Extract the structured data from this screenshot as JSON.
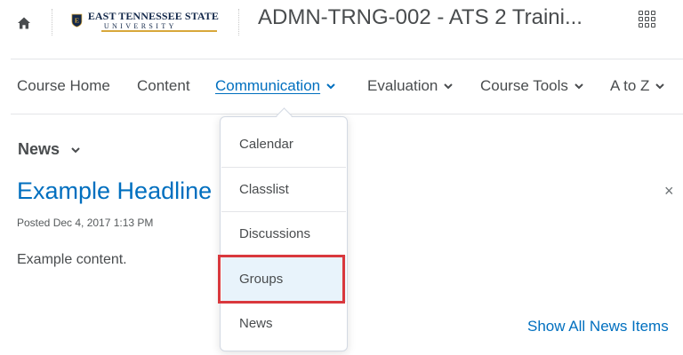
{
  "header": {
    "home_icon": "home-icon",
    "logo": {
      "line1": "EAST TENNESSEE STATE",
      "line2": "UNIVERSITY",
      "shield_letter": "E",
      "navy": "#13284a",
      "gold": "#d8a73a"
    },
    "course_title": "ADMN-TRNG-002 - ATS 2 Traini...",
    "apps_icon": "waffle-grid-icon"
  },
  "nav": {
    "items": [
      {
        "label": "Course Home",
        "has_menu": false
      },
      {
        "label": "Content",
        "has_menu": false
      },
      {
        "label": "Communication",
        "has_menu": true,
        "active": true
      },
      {
        "label": "Evaluation",
        "has_menu": true
      },
      {
        "label": "Course Tools",
        "has_menu": true
      },
      {
        "label": "A to Z",
        "has_menu": true
      }
    ]
  },
  "dropdown": {
    "items": [
      {
        "label": "Calendar"
      },
      {
        "label": "Classlist"
      },
      {
        "label": "Discussions"
      },
      {
        "label": "Groups",
        "highlighted": true
      },
      {
        "label": "News"
      }
    ]
  },
  "news": {
    "heading": "News",
    "headline": "Example Headline",
    "posted": "Posted Dec 4, 2017 1:13 PM",
    "content": "Example content.",
    "close": "×",
    "show_all": "Show All News Items"
  },
  "colors": {
    "link": "#006fbf",
    "text": "#494c4e",
    "highlight_border": "#d9383d",
    "highlight_bg": "#e8f3fb"
  }
}
